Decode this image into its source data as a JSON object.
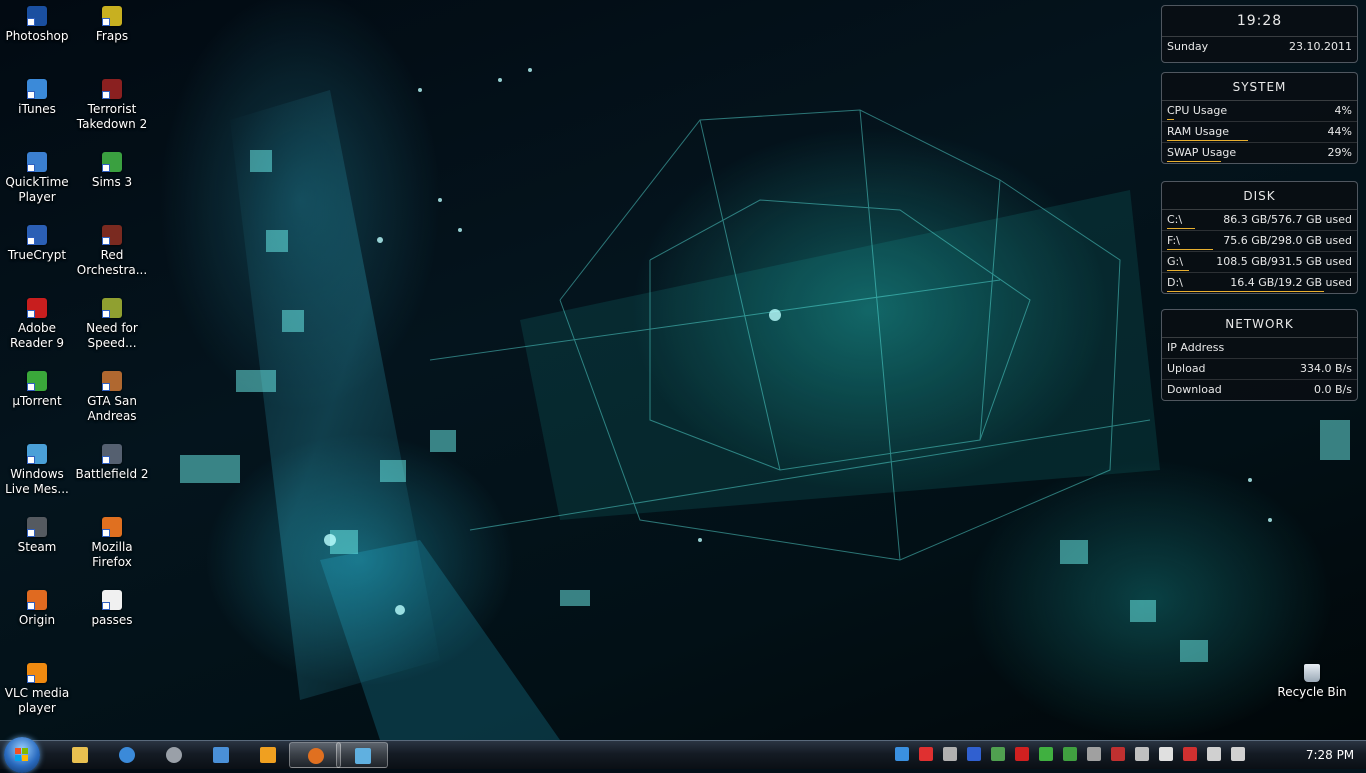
{
  "desktop": {
    "icons_col1": [
      {
        "label": "Photoshop",
        "color": "#1a4fa0"
      },
      {
        "label": "iTunes",
        "color": "#3b8ad9"
      },
      {
        "label": "QuickTime Player",
        "color": "#3b7fd0"
      },
      {
        "label": "TrueCrypt",
        "color": "#2b5fb5"
      },
      {
        "label": "Adobe Reader 9",
        "color": "#c81e1e"
      },
      {
        "label": "µTorrent",
        "color": "#3aa83a"
      },
      {
        "label": "Windows Live Mes...",
        "color": "#4aa0d8"
      },
      {
        "label": "Steam",
        "color": "#555a60"
      },
      {
        "label": "Origin",
        "color": "#e06a20"
      },
      {
        "label": "VLC media player",
        "color": "#f08a10"
      }
    ],
    "icons_col2": [
      {
        "label": "Fraps",
        "color": "#c8b020"
      },
      {
        "label": "Terrorist Takedown 2",
        "color": "#8a2020"
      },
      {
        "label": "Sims 3",
        "color": "#3aa040"
      },
      {
        "label": "Red Orchestra...",
        "color": "#7a2a20"
      },
      {
        "label": "Need for Speed...",
        "color": "#90a030"
      },
      {
        "label": "GTA San Andreas",
        "color": "#b06830"
      },
      {
        "label": "Battlefield 2",
        "color": "#556070"
      },
      {
        "label": "Mozilla Firefox",
        "color": "#e07020"
      },
      {
        "label": "passes",
        "color": "#f0f0f0"
      }
    ],
    "recycle_bin": "Recycle Bin"
  },
  "gadgets": {
    "clock": {
      "time": "19:28",
      "day": "Sunday",
      "date": "23.10.2011"
    },
    "system": {
      "title": "SYSTEM",
      "rows": [
        {
          "label": "CPU Usage",
          "value": "4%",
          "level": 0.04
        },
        {
          "label": "RAM Usage",
          "value": "44%",
          "level": 0.44
        },
        {
          "label": "SWAP Usage",
          "value": "29%",
          "level": 0.29
        }
      ]
    },
    "disk": {
      "title": "DISK",
      "rows": [
        {
          "label": "C:\\",
          "value": "86.3 GB/576.7 GB used",
          "level": 0.15
        },
        {
          "label": "F:\\",
          "value": "75.6 GB/298.0 GB used",
          "level": 0.25
        },
        {
          "label": "G:\\",
          "value": "108.5 GB/931.5 GB used",
          "level": 0.12
        },
        {
          "label": "D:\\",
          "value": "16.4 GB/19.2 GB used",
          "level": 0.85
        }
      ]
    },
    "network": {
      "title": "NETWORK",
      "rows": [
        {
          "label": "IP Address",
          "value": ""
        },
        {
          "label": "Upload",
          "value": "334.0 B/s"
        },
        {
          "label": "Download",
          "value": "0.0 B/s"
        }
      ]
    }
  },
  "taskbar": {
    "pinned": [
      {
        "name": "explorer",
        "color": "#e8c050",
        "active": false
      },
      {
        "name": "internet-explorer",
        "color": "#3b8ad9",
        "active": false
      },
      {
        "name": "steam",
        "color": "#9aa0a8",
        "active": false
      },
      {
        "name": "outlook",
        "color": "#4a90d8",
        "active": false
      },
      {
        "name": "media-player",
        "color": "#f0a020",
        "active": false
      },
      {
        "name": "firefox",
        "color": "#e07020",
        "active": true
      },
      {
        "name": "network-app",
        "color": "#60b0e0",
        "active": true
      }
    ],
    "tray_icons": [
      {
        "name": "uplay-icon",
        "color": "#3a90e0"
      },
      {
        "name": "origin-tray-icon",
        "color": "#e03030"
      },
      {
        "name": "media-icon",
        "color": "#b0b0b0"
      },
      {
        "name": "bluetooth-icon",
        "color": "#3060d0"
      },
      {
        "name": "monitor-icon",
        "color": "#50a050"
      },
      {
        "name": "ati-icon",
        "color": "#d02020"
      },
      {
        "name": "wifi-icon",
        "color": "#40b040"
      },
      {
        "name": "security-icon",
        "color": "#40a040"
      },
      {
        "name": "steam-tray-icon",
        "color": "#a0a0a0"
      },
      {
        "name": "game-icon",
        "color": "#c03030"
      },
      {
        "name": "drop-icon",
        "color": "#c0c0c0"
      },
      {
        "name": "flag-icon",
        "color": "#e0e0e0"
      },
      {
        "name": "power-icon",
        "color": "#d03030"
      },
      {
        "name": "signal-icon",
        "color": "#d0d0d0"
      },
      {
        "name": "volume-icon",
        "color": "#d0d0d0"
      }
    ],
    "clock": "7:28 PM"
  }
}
